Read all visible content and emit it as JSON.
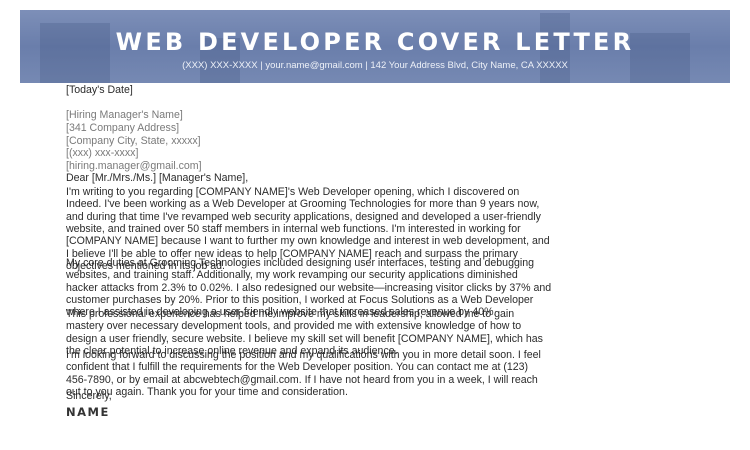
{
  "header": {
    "title": "WEB DEVELOPER COVER LETTER",
    "contact": "(XXX) XXX-XXXX  |  your.name@gmail.com  |  142 Your Address Blvd, City Name, CA XXXXX"
  },
  "date": "[Today's Date]",
  "recipient": [
    "[Hiring Manager's Name]",
    "[341 Company Address]",
    "[Company City, State, xxxxx]",
    "[(xxx) xxx-xxxx]",
    "[hiring.manager@gmail.com]"
  ],
  "salutation": "Dear [Mr./Mrs./Ms.] [Manager's Name],",
  "paragraphs": [
    [
      "I'm writing to you regarding [COMPANY NAME]'s Web Developer opening, which I discovered on",
      "Indeed. I've been working as a Web Developer at Grooming Technologies for more than 9 years now,",
      "and during that time I've revamped web security applications, designed and developed a user-friendly",
      "website, and trained over 50 staff members in internal web functions. I'm interested in working for",
      "[COMPANY NAME] because I want to further my own knowledge and interest in web development, and",
      "I believe I'll be able to offer new ideas to help [COMPANY NAME] reach and surpass the primary",
      "objectives mentioned in its job ad."
    ],
    [
      "My core duties at Grooming Technologies included designing user interfaces, testing and debugging",
      "websites, and training staff. Additionally, my work revamping our security applications diminished",
      "hacker attacks from 2.3% to 0.02%. I also redesigned our website—increasing visitor clicks by 37% and",
      "customer purchases by 20%. Prior to this position, I worked at Focus Solutions as a Web Developer",
      "where I assisted in developing a user-friendly website that increased sales revenue by 40%."
    ],
    [
      "This professional experience has helped me improve my skills in leadership, allowed me to gain",
      "mastery over necessary development tools, and provided me with extensive knowledge of how to",
      "design a user friendly, secure website. I believe my skill set will benefit [COMPANY NAME], which has",
      "the clear potential to increase online revenue and expand its audience."
    ],
    [
      "I'm looking forward to discussing the position and my qualifications with you in more detail soon. I feel",
      "confident that I fulfill the requirements for the Web Developer position. You can contact me at (123)",
      "456-7890, or by email at abcwebtech@gmail.com. If I have not heard from you in a week, I will reach",
      "out to you again. Thank you for your time and consideration."
    ]
  ],
  "closing": "Sincerely,",
  "signature": "NAME"
}
